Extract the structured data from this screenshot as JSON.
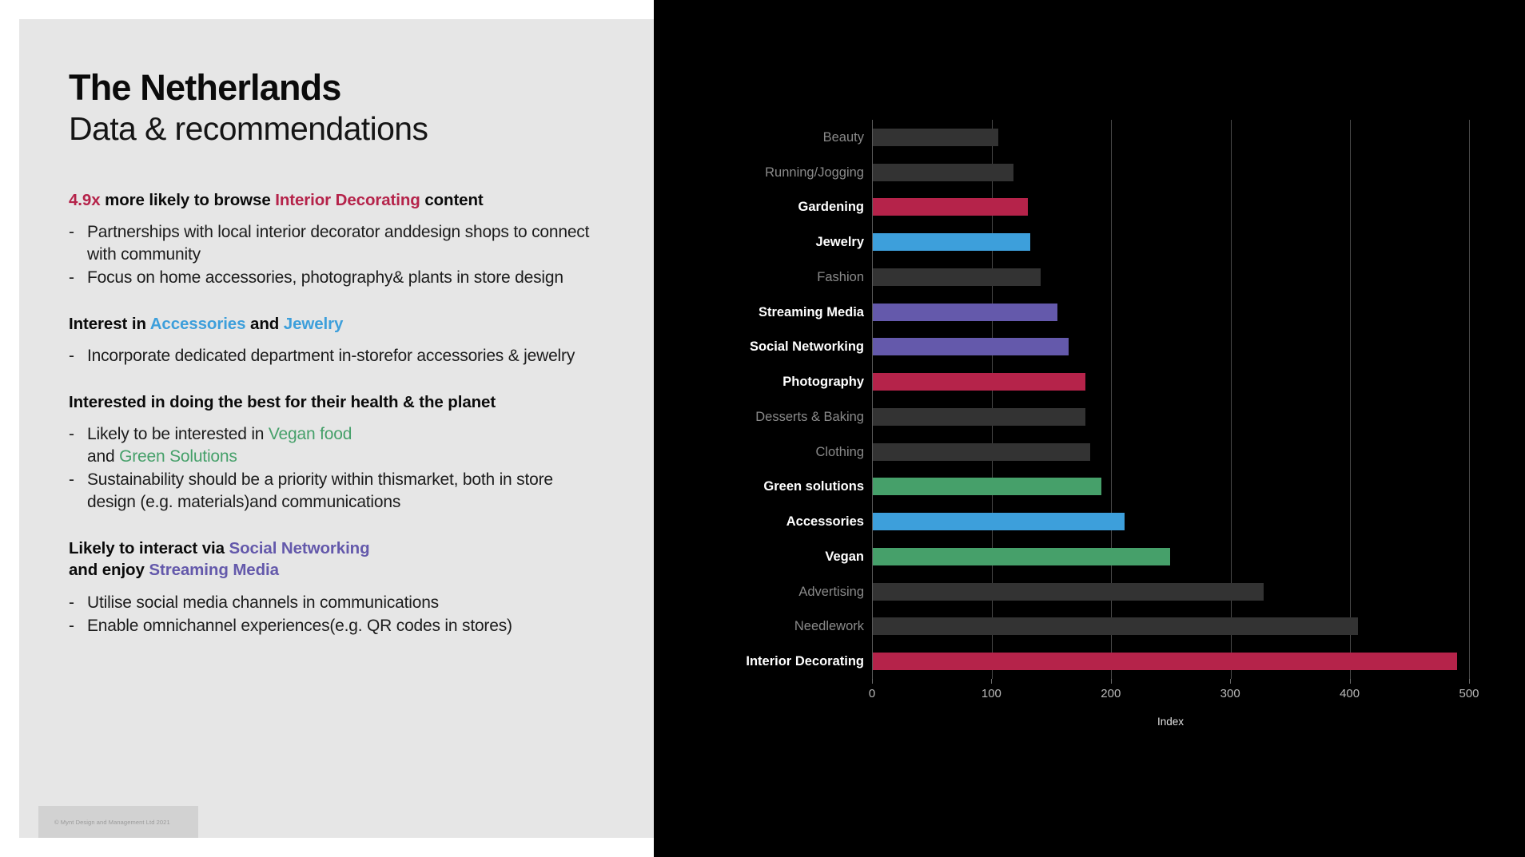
{
  "slide": {
    "title": "The Netherlands",
    "subtitle": "Data & recommendations",
    "footer": "© Mynt Design and Management Ltd 2021"
  },
  "colors": {
    "background_left": "#e6e6e6",
    "background_right": "#000000",
    "red": "#b5234a",
    "blue": "#3d9fdb",
    "green": "#46a06a",
    "purple": "#6459ab",
    "gray": "#333333"
  },
  "sections": [
    {
      "head_parts": [
        {
          "text": "4.9x",
          "style": "accent-red"
        },
        {
          "text": " more likely to browse ",
          "style": "plain"
        },
        {
          "text": "Interior Decorating",
          "style": "accent-red"
        },
        {
          "text": " content",
          "style": "plain"
        }
      ],
      "bullets": [
        [
          {
            "text": "Partnerships with local interior decorator and",
            "style": "plain"
          },
          {
            "text": "design shops to connect with community",
            "style": "plain"
          }
        ],
        [
          {
            "text": "Focus on home accessories, photography",
            "style": "plain"
          },
          {
            "text": "& plants in store design",
            "style": "plain"
          }
        ]
      ]
    },
    {
      "head_parts": [
        {
          "text": "Interest in ",
          "style": "plain"
        },
        {
          "text": "Accessories",
          "style": "accent-blue"
        },
        {
          "text": " and ",
          "style": "plain"
        },
        {
          "text": "Jewelry",
          "style": "accent-blue"
        }
      ],
      "bullets": [
        [
          {
            "text": "Incorporate dedicated department in-store",
            "style": "plain"
          },
          {
            "text": "for accessories & jewelry",
            "style": "plain"
          }
        ]
      ]
    },
    {
      "head_parts": [
        {
          "text": "Interested in doing the best for their health & the planet",
          "style": "plain"
        }
      ],
      "bullets": [
        [
          {
            "text": "Likely to be interested in ",
            "style": "plain"
          },
          {
            "text": "Vegan food",
            "style": "accent-green"
          },
          {
            "text": "\nand ",
            "style": "plain"
          },
          {
            "text": "Green Solutions",
            "style": "accent-green"
          }
        ],
        [
          {
            "text": "Sustainability should be a priority within this",
            "style": "plain"
          },
          {
            "text": "market, both in store design (e.g. materials)",
            "style": "plain"
          },
          {
            "text": "and communications",
            "style": "plain"
          }
        ]
      ]
    },
    {
      "head_parts": [
        {
          "text": "Likely to interact via ",
          "style": "plain"
        },
        {
          "text": "Social Networking",
          "style": "accent-purple"
        },
        {
          "text": "\nand enjoy ",
          "style": "plain"
        },
        {
          "text": "Streaming Media",
          "style": "accent-purple"
        }
      ],
      "bullets": [
        [
          {
            "text": "Utilise social media channels in communications",
            "style": "plain"
          }
        ],
        [
          {
            "text": "Enable omnichannel experiences",
            "style": "plain"
          },
          {
            "text": "(e.g. QR codes in stores)",
            "style": "plain"
          }
        ]
      ]
    }
  ],
  "chart_data": {
    "type": "bar",
    "orientation": "horizontal",
    "title": "",
    "xlabel": "Index",
    "ylabel": "",
    "xlim": [
      0,
      500
    ],
    "xticks": [
      0,
      100,
      200,
      300,
      400,
      500
    ],
    "grid": true,
    "legend": "none",
    "categories": [
      "Beauty",
      "Running/Jogging",
      "Gardening",
      "Jewelry",
      "Fashion",
      "Streaming Media",
      "Social Networking",
      "Photography",
      "Desserts & Baking",
      "Clothing",
      "Green solutions",
      "Accessories",
      "Vegan",
      "Advertising",
      "Needlework",
      "Interior Decorating"
    ],
    "values": [
      105,
      118,
      130,
      132,
      141,
      155,
      164,
      178,
      178,
      182,
      192,
      211,
      249,
      328,
      407,
      490
    ],
    "bar_colors": [
      "#333333",
      "#333333",
      "#b5234a",
      "#3d9fdb",
      "#333333",
      "#6459ab",
      "#6459ab",
      "#b5234a",
      "#333333",
      "#333333",
      "#46a06a",
      "#3d9fdb",
      "#46a06a",
      "#333333",
      "#333333",
      "#b5234a"
    ],
    "label_emphasis": [
      "muted",
      "muted",
      "strong",
      "strong",
      "muted",
      "strong",
      "strong",
      "strong",
      "muted",
      "muted",
      "strong",
      "strong",
      "strong",
      "muted",
      "muted",
      "strong"
    ]
  }
}
